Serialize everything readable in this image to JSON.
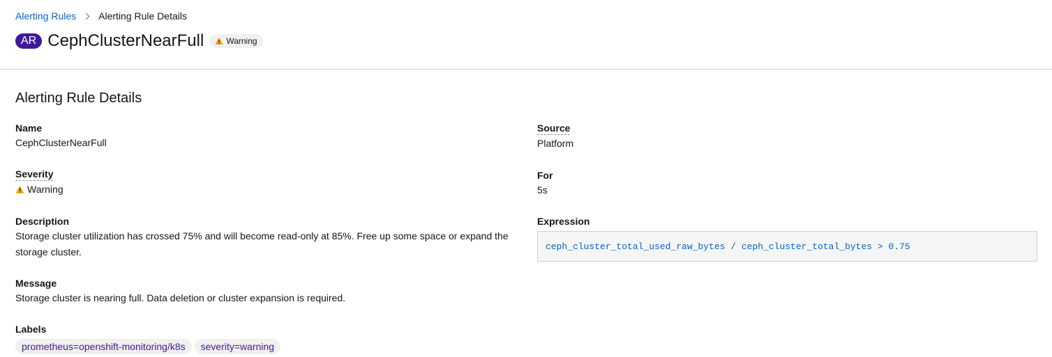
{
  "breadcrumb": {
    "parent": "Alerting Rules",
    "current": "Alerting Rule Details"
  },
  "header": {
    "badge": "AR",
    "title": "CephClusterNearFull",
    "severity_pill": "Warning"
  },
  "section": {
    "title": "Alerting Rule Details"
  },
  "details": {
    "name_label": "Name",
    "name_value": "CephClusterNearFull",
    "severity_label": "Severity",
    "severity_value": "Warning",
    "description_label": "Description",
    "description_value": "Storage cluster utilization has crossed 75% and will become read-only at 85%. Free up some space or expand the storage cluster.",
    "message_label": "Message",
    "message_value": "Storage cluster is nearing full. Data deletion or cluster expansion is required.",
    "labels_label": "Labels",
    "labels": [
      "prometheus=openshift-monitoring/k8s",
      "severity=warning"
    ],
    "source_label": "Source",
    "source_value": "Platform",
    "for_label": "For",
    "for_value": "5s",
    "expression_label": "Expression",
    "expression_value": "ceph_cluster_total_used_raw_bytes / ceph_cluster_total_bytes > 0.75"
  },
  "colors": {
    "link": "#0066cc",
    "badge": "#40199a",
    "warning": "#f0ab00"
  },
  "icons": {
    "breadcrumb_separator": "chevron-right-icon",
    "warning": "warning-triangle-icon"
  }
}
